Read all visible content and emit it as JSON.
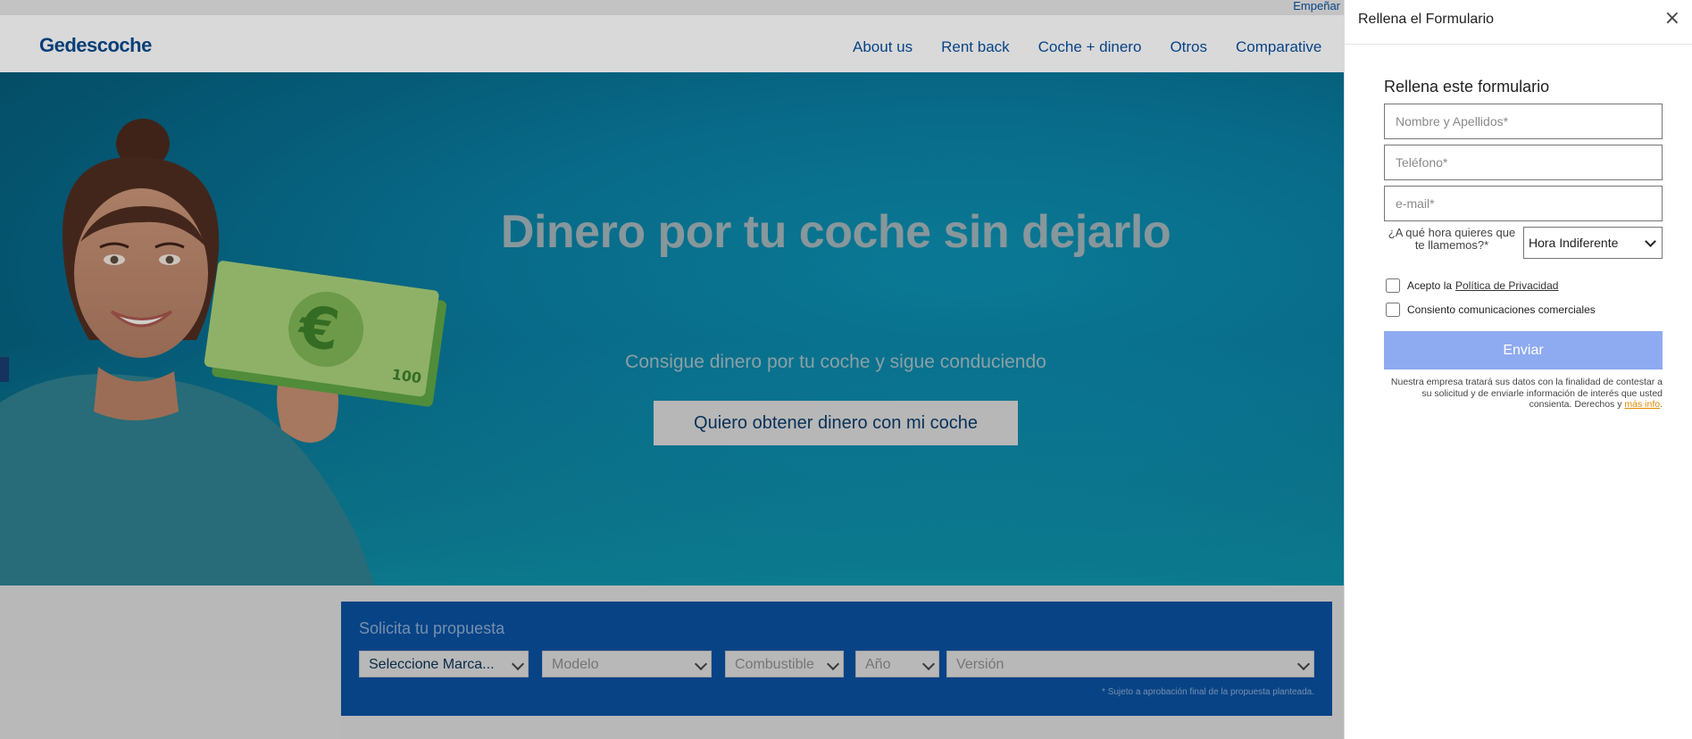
{
  "site": {
    "top_link": "Empeñar",
    "logo": "Gedescoche",
    "nav": [
      "About us",
      "Rent back",
      "Coche + dinero",
      "Otros",
      "Comparative"
    ]
  },
  "hero": {
    "title": "Dinero por tu coche sin dejarlo",
    "subtitle": "Consigue dinero por tu coche y sigue conduciendo",
    "cta": "Quiero obtener dinero con mi coche"
  },
  "proposal": {
    "title": "Solicita tu propuesta",
    "selects": [
      "Seleccione Marca...",
      "Modelo",
      "Combustible",
      "Año",
      "Versión"
    ],
    "note": "* Sujeto a aprobación final de la propuesta planteada."
  },
  "panel": {
    "header": "Rellena el Formulario",
    "close": "×",
    "form_title": "Rellena este formulario",
    "name_placeholder": "Nombre y Apellidos*",
    "phone_placeholder": "Teléfono*",
    "email_placeholder": "e-mail*",
    "time_label": "¿A qué hora quieres que te llamemos?*",
    "time_value": "Hora Indiferente",
    "privacy_prefix": "Acepto la",
    "privacy_link": "Política de Privacidad",
    "commercial": "Consiento comunicaciones comerciales",
    "submit": "Enviar",
    "legal_text": "Nuestra empresa tratará sus datos con la finalidad de contestar a su solicitud y de enviarle información de interés que usted consienta. Derechos y",
    "legal_link": "más info",
    "legal_end": "."
  },
  "colors": {
    "brand": "#0a4f9e",
    "submit": "#8eaaf0",
    "hero": "#0a7ea1"
  }
}
